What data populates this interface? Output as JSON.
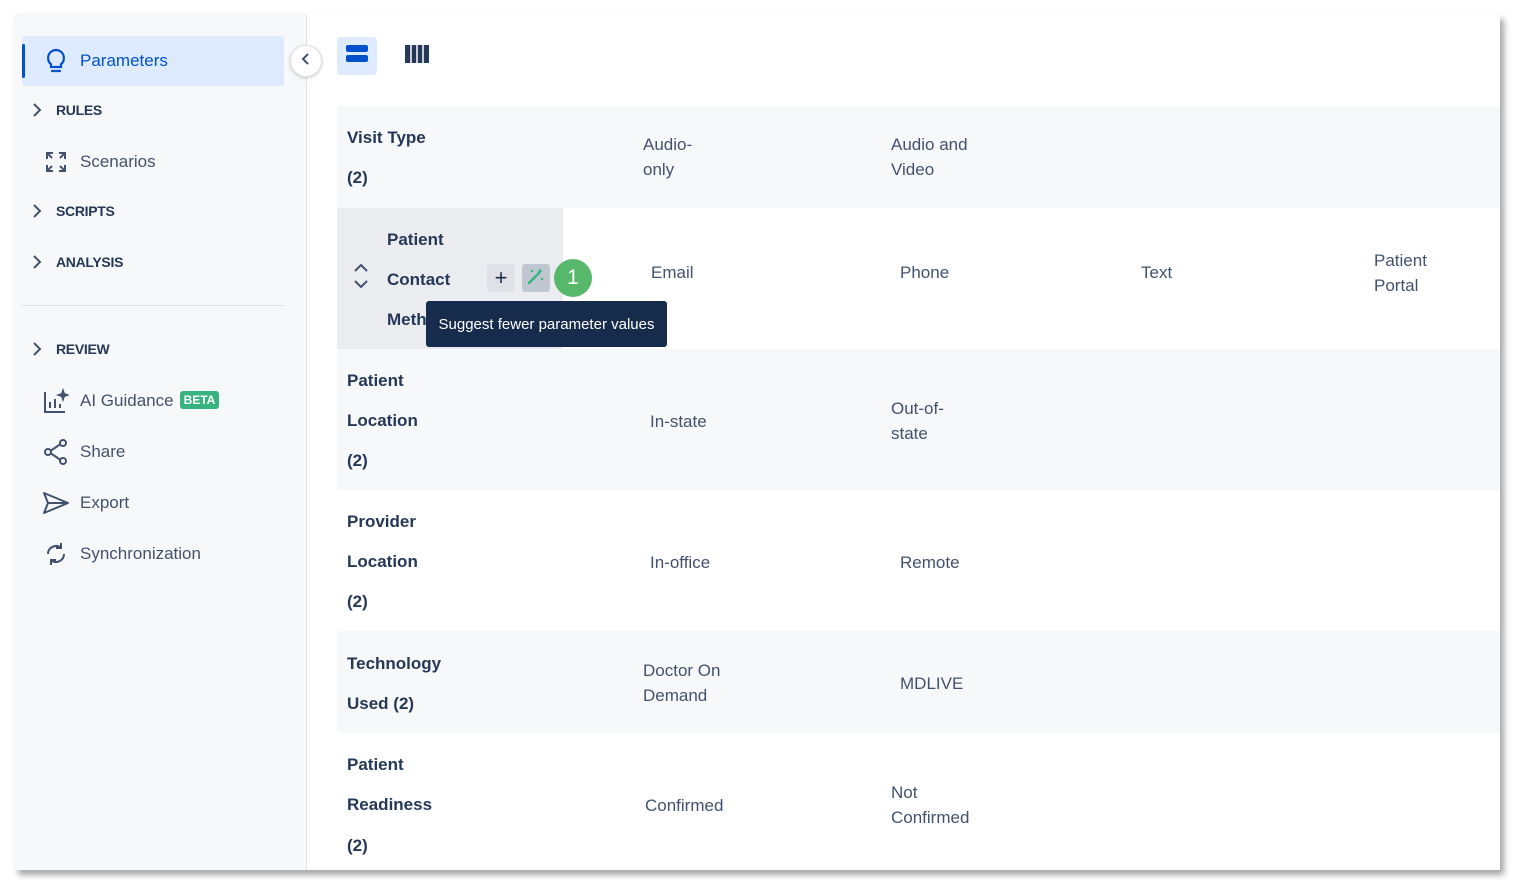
{
  "sidebar": {
    "items": [
      {
        "label": "Parameters",
        "icon": "lightbulb-icon",
        "active": true
      },
      {
        "label": "Scenarios",
        "icon": "expand-arrows-icon"
      },
      {
        "label": "AI Guidance",
        "icon": "ai-chart-icon",
        "badge": "BETA"
      },
      {
        "label": "Share",
        "icon": "share-icon"
      },
      {
        "label": "Export",
        "icon": "send-icon"
      },
      {
        "label": "Synchronization",
        "icon": "sync-icon"
      }
    ],
    "sections": [
      "RULES",
      "SCRIPTS",
      "ANALYSIS",
      "REVIEW"
    ]
  },
  "toolbar": {
    "views": [
      "rows-view-icon",
      "columns-view-icon"
    ]
  },
  "parameters": [
    {
      "name_lines": [
        "Visit Type",
        "(2)"
      ],
      "values": [
        "Audio-\nonly",
        "Audio and\nVideo"
      ]
    },
    {
      "name_lines": [
        "Patient",
        "Contact",
        "Meth"
      ],
      "values": [
        "Email",
        "Phone",
        "Text",
        "Patient\nPortal"
      ]
    },
    {
      "name_lines": [
        "Patient",
        "Location",
        "(2)"
      ],
      "values": [
        "In-state",
        "Out-of-\nstate"
      ]
    },
    {
      "name_lines": [
        "Provider",
        "Location",
        "(2)"
      ],
      "values": [
        "In-office",
        "Remote"
      ]
    },
    {
      "name_lines": [
        "Technology",
        "Used (2)"
      ],
      "values": [
        "Doctor On\nDemand",
        "MDLIVE"
      ]
    },
    {
      "name_lines": [
        "Patient",
        "Readiness",
        "(2)"
      ],
      "values": [
        "Confirmed",
        "Not\nConfirmed"
      ]
    }
  ],
  "hover_actions": {
    "add": "+",
    "tooltip": "Suggest fewer parameter values",
    "step_badge": "1"
  },
  "colors": {
    "accent": "#0052cc",
    "badge": "#57b76b",
    "beta": "#36b37e",
    "tooltip_bg": "#172b4d"
  }
}
